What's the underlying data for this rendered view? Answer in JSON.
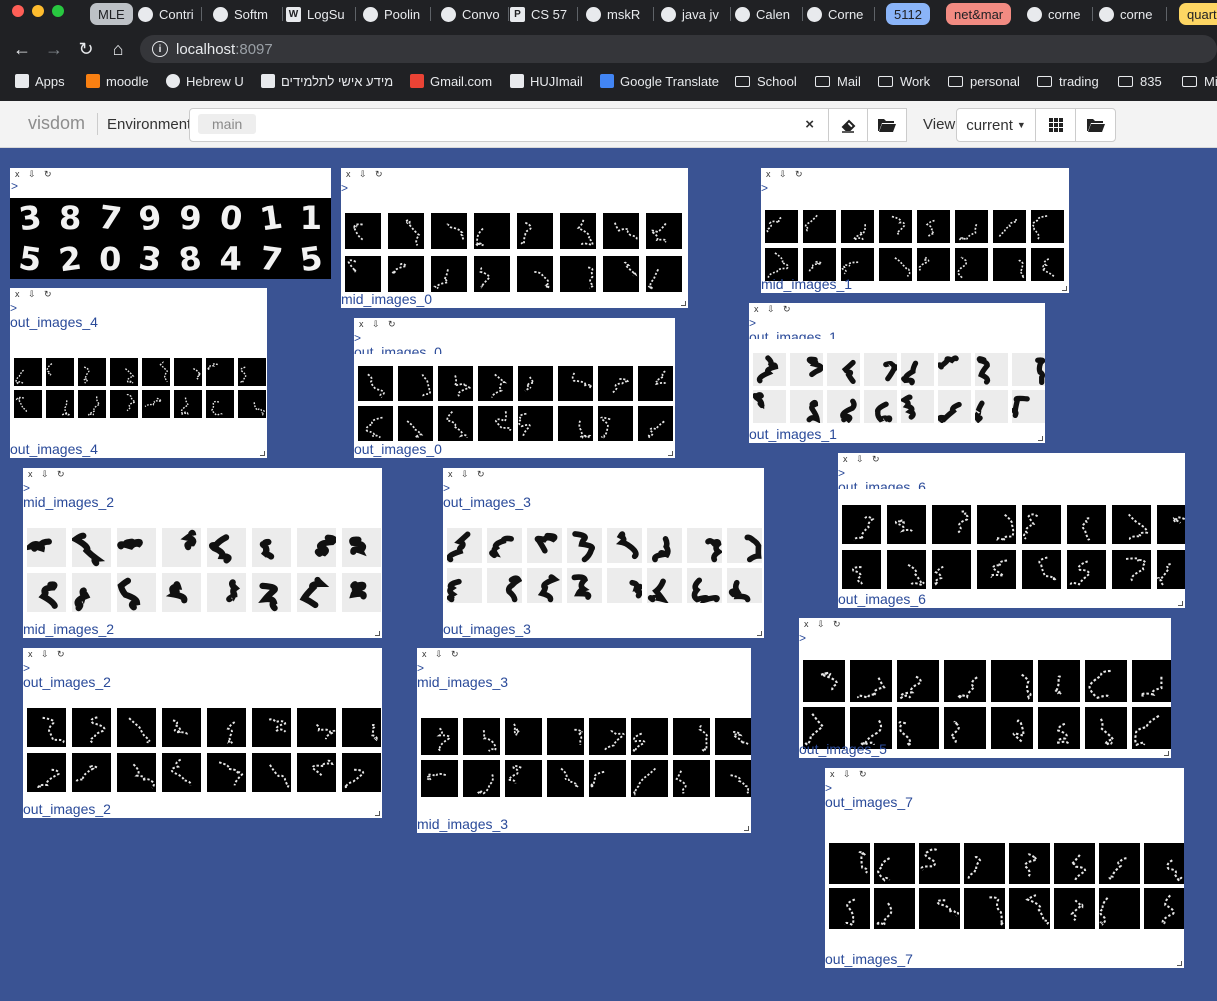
{
  "browser": {
    "tabs": [
      {
        "label": "MLE",
        "kind": "group-gray"
      },
      {
        "label": "Contri"
      },
      {
        "label": "Softm"
      },
      {
        "label": "LogSu",
        "icon": "W"
      },
      {
        "label": "Poolin"
      },
      {
        "label": "Convo"
      },
      {
        "label": "CS 57",
        "icon": "P"
      },
      {
        "label": "mskR"
      },
      {
        "label": "java jv"
      },
      {
        "label": "Calen"
      },
      {
        "label": "Corne"
      },
      {
        "label": "5112",
        "kind": "group-blue"
      },
      {
        "label": "net&mar",
        "kind": "group-red"
      },
      {
        "label": "corne"
      },
      {
        "label": "corne"
      },
      {
        "label": "quarte",
        "kind": "group-yellow"
      }
    ],
    "address": {
      "host": "localhost",
      "port": ":8097"
    },
    "bookmarks": [
      {
        "label": "Apps",
        "icon": "apps-grid-icon"
      },
      {
        "label": "moodle",
        "icon": "moodle-icon"
      },
      {
        "label": "Hebrew U",
        "icon": "globe-icon"
      },
      {
        "label": "מידע אישי לתלמידים",
        "icon": "huji-icon"
      },
      {
        "label": "Gmail.com",
        "icon": "gmail-icon"
      },
      {
        "label": "HUJImail",
        "icon": "huji-icon"
      },
      {
        "label": "Google Translate",
        "icon": "translate-icon"
      },
      {
        "label": "School",
        "icon": "folder-icon"
      },
      {
        "label": "Mail",
        "icon": "folder-icon"
      },
      {
        "label": "Work",
        "icon": "folder-icon"
      },
      {
        "label": "personal",
        "icon": "folder-icon"
      },
      {
        "label": "trading",
        "icon": "folder-icon"
      },
      {
        "label": "835",
        "icon": "folder-icon"
      },
      {
        "label": "Mi",
        "icon": "folder-icon"
      }
    ]
  },
  "visdom": {
    "brand": "visdom",
    "environment_label": "Environment",
    "environment_value": "main",
    "clear_symbol": "×",
    "view_label": "View",
    "view_value": "current",
    "colors": {
      "background": "#3a5393",
      "pane_title": "#2a4a99"
    }
  },
  "window_controls": "x ⇩ ↻",
  "arrow": ">",
  "input_digits": [
    "3",
    "8",
    "7",
    "9",
    "9",
    "0",
    "1",
    "1",
    "5",
    "2",
    "0",
    "3",
    "8",
    "4",
    "7",
    "5"
  ],
  "panes": [
    {
      "id": "input",
      "title": "",
      "footer": ""
    },
    {
      "id": "mid0",
      "title": "",
      "footer": "mid_images_0"
    },
    {
      "id": "mid1",
      "title": "",
      "footer": "mid_images_1"
    },
    {
      "id": "out4",
      "title": "out_images_4",
      "footer": "out_images_4"
    },
    {
      "id": "out0",
      "title": "out_images_0",
      "footer": "out_images_0"
    },
    {
      "id": "out1",
      "title": "out_images_1",
      "footer": "out_images_1"
    },
    {
      "id": "mid2",
      "title": "mid_images_2",
      "footer": "mid_images_2"
    },
    {
      "id": "out3",
      "title": "out_images_3",
      "footer": "out_images_3"
    },
    {
      "id": "out6",
      "title": "out_images_6",
      "footer": "out_images_6"
    },
    {
      "id": "out5",
      "title": "",
      "footer": "out_images_5"
    },
    {
      "id": "out2",
      "title": "out_images_2",
      "footer": "out_images_2"
    },
    {
      "id": "mid3",
      "title": "mid_images_3",
      "footer": "mid_images_3"
    },
    {
      "id": "out7",
      "title": "out_images_7",
      "footer": "out_images_7"
    }
  ]
}
